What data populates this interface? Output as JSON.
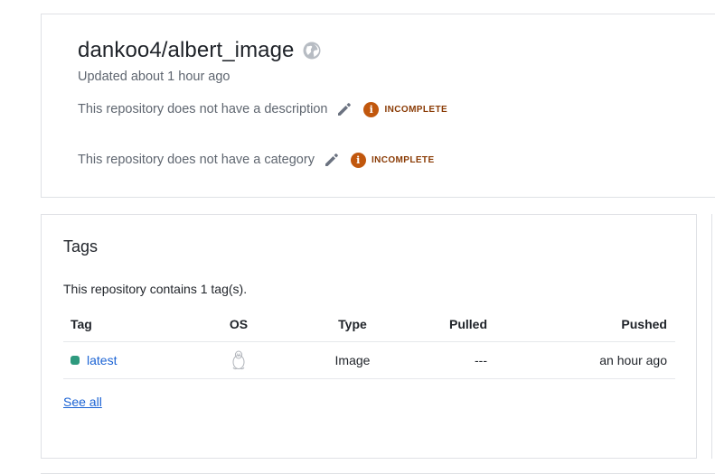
{
  "repo": {
    "title": "dankoo4/albert_image",
    "visibility_icon": "globe-icon",
    "updated": "Updated about 1 hour ago",
    "description_text": "This repository does not have a description",
    "category_text": "This repository does not have a category",
    "badge_label": "INCOMPLETE",
    "badge_icon": "info-icon"
  },
  "tags": {
    "heading": "Tags",
    "count_text": "This repository contains 1 tag(s).",
    "columns": {
      "tag": "Tag",
      "os": "OS",
      "type": "Type",
      "pulled": "Pulled",
      "pushed": "Pushed"
    },
    "rows": [
      {
        "tag": "latest",
        "os_icon": "linux-tux-icon",
        "type": "Image",
        "pulled": "---",
        "pushed": "an hour ago"
      }
    ],
    "see_all": "See all"
  },
  "colors": {
    "link": "#1b63d4",
    "badge": "#c1570d",
    "status": "#2e9a7e"
  }
}
